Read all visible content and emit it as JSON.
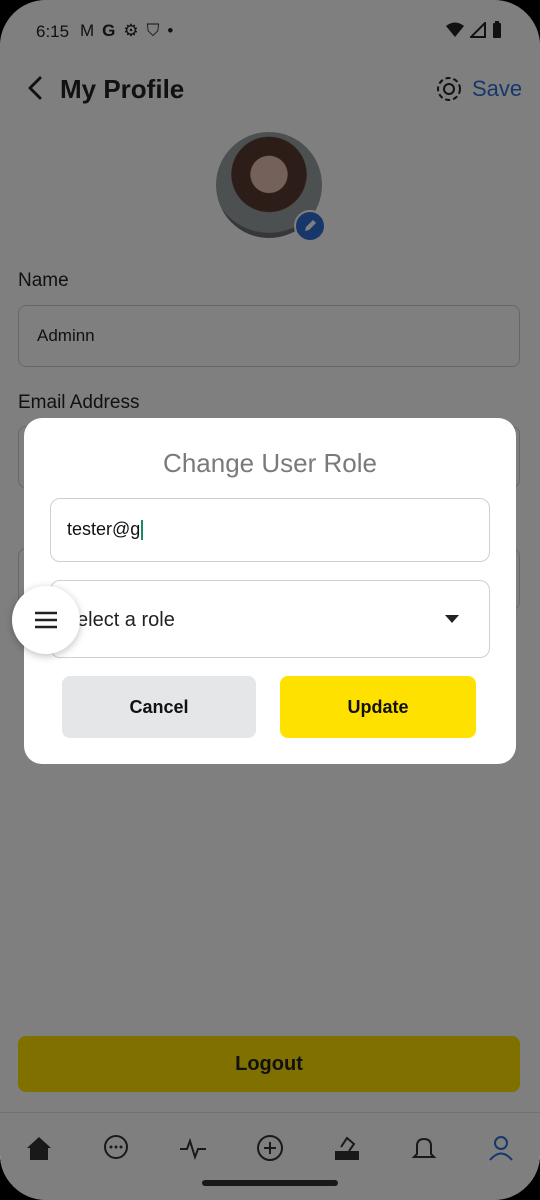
{
  "status": {
    "time": "6:15",
    "icons": [
      "gmail-icon",
      "google-icon",
      "gear-icon",
      "shield-icon",
      "dot-icon"
    ],
    "right_icons": [
      "wifi-icon",
      "signal-icon",
      "battery-icon"
    ]
  },
  "header": {
    "title": "My Profile",
    "save_label": "Save"
  },
  "profile": {
    "name_label": "Name",
    "name_value": "Adminn",
    "email_label": "Email Address"
  },
  "dialog": {
    "title": "Change User Role",
    "email_value": "tester@g",
    "role_placeholder": "elect a role",
    "cancel_label": "Cancel",
    "update_label": "Update"
  },
  "logout_label": "Logout",
  "nav": [
    "home-icon",
    "chat-icon",
    "activity-icon",
    "add-icon",
    "vote-icon",
    "bell-icon",
    "profile-icon"
  ],
  "colors": {
    "accent_yellow": "#ffe100",
    "save_blue": "#2f6fd6"
  }
}
